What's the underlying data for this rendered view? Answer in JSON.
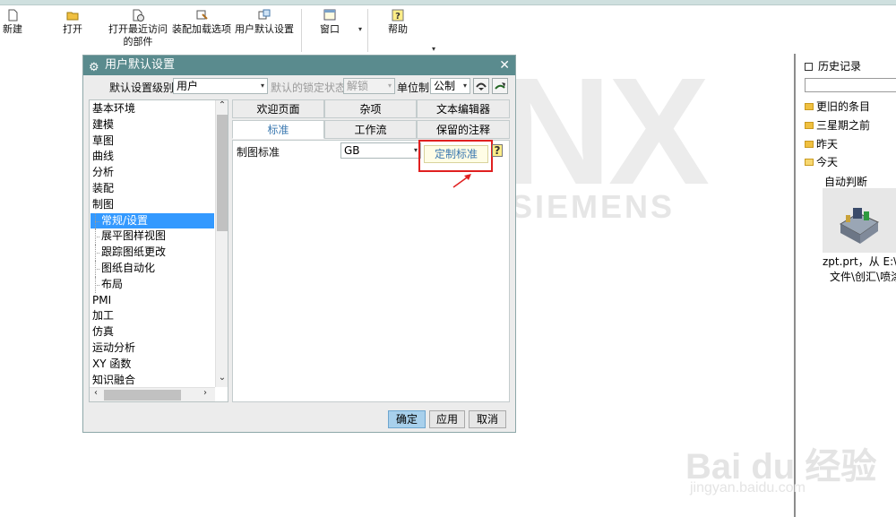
{
  "ribbon": {
    "buttons": [
      {
        "label": "新建",
        "icon": "new-file-icon"
      },
      {
        "label": "打开",
        "icon": "open-folder-icon"
      },
      {
        "label": "打开最近访问的部件",
        "icon": "recent-parts-icon"
      },
      {
        "label": "装配加载选项",
        "icon": "assembly-load-icon"
      },
      {
        "label": "用户默认设置",
        "icon": "user-defaults-icon"
      },
      {
        "label": "窗口",
        "icon": "window-icon"
      },
      {
        "label": "帮助",
        "icon": "help-icon"
      }
    ]
  },
  "watermark": {
    "nx": "NX",
    "siemens": "SIEMENS"
  },
  "dialog": {
    "title": "用户默认设置",
    "level_label": "默认设置级别",
    "level_value": "用户",
    "lock_label": "默认的锁定状态",
    "lock_value": "解锁",
    "unit_label": "单位制",
    "unit_value": "公制",
    "tree": [
      {
        "label": "基本环境",
        "sub": false
      },
      {
        "label": "建模",
        "sub": false
      },
      {
        "label": "草图",
        "sub": false
      },
      {
        "label": "曲线",
        "sub": false
      },
      {
        "label": "分析",
        "sub": false
      },
      {
        "label": "装配",
        "sub": false
      },
      {
        "label": "制图",
        "sub": false
      },
      {
        "label": "常规/设置",
        "sub": true,
        "selected": true
      },
      {
        "label": "展平图样视图",
        "sub": true
      },
      {
        "label": "跟踪图纸更改",
        "sub": true
      },
      {
        "label": "图纸自动化",
        "sub": true
      },
      {
        "label": "布局",
        "sub": true
      },
      {
        "label": "PMI",
        "sub": false
      },
      {
        "label": "加工",
        "sub": false
      },
      {
        "label": "仿真",
        "sub": false
      },
      {
        "label": "运动分析",
        "sub": false
      },
      {
        "label": "XY 函数",
        "sub": false
      },
      {
        "label": "知识融合",
        "sub": false
      }
    ],
    "tabs_row1": [
      "欢迎页面",
      "杂项",
      "文本编辑器"
    ],
    "tabs_row2": [
      "标准",
      "工作流",
      "保留的注释"
    ],
    "std_label": "制图标准",
    "std_value": "GB",
    "customize_button": "定制标准",
    "ok": "确定",
    "apply": "应用",
    "cancel": "取消"
  },
  "history": {
    "title": "历史记录",
    "groups": [
      "更旧的条目",
      "三星期之前",
      "昨天",
      "今天"
    ],
    "today_item": "自动判断",
    "file_line1": "zpt.prt，从 E:\\u",
    "file_line2": "文件\\创汇\\喷涂"
  },
  "baidu": {
    "logo": "Bai du 经验",
    "url": "jingyan.baidu.com"
  },
  "colors": {
    "title_bar": "#5a8b8e",
    "selected": "#3399ff",
    "highlight": "#e02020",
    "link": "#3a78b0"
  }
}
